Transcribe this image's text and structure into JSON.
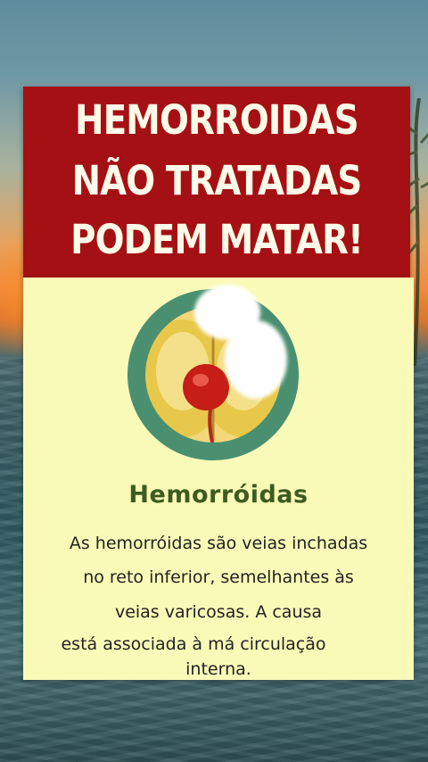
{
  "banner": {
    "line1": "HEMORROIDAS",
    "line2": "NÃO TRATADAS",
    "line3": "PODEM MATAR!"
  },
  "card": {
    "title": "Hemorróidas",
    "description_lines": [
      "As hemorróidas são veias inchadas",
      "no reto inferior, semelhantes às",
      "veias varicosas. A causa",
      "está associada à má circulação",
      "interna."
    ],
    "illustration_icon": "hemorrhoid-illustration-icon"
  },
  "colors": {
    "banner_bg": "#a51014",
    "banner_text": "#fffbe8",
    "card_bg": "#fafab8",
    "title_text": "#3f5b1e",
    "circle_ring": "#4a9070"
  }
}
